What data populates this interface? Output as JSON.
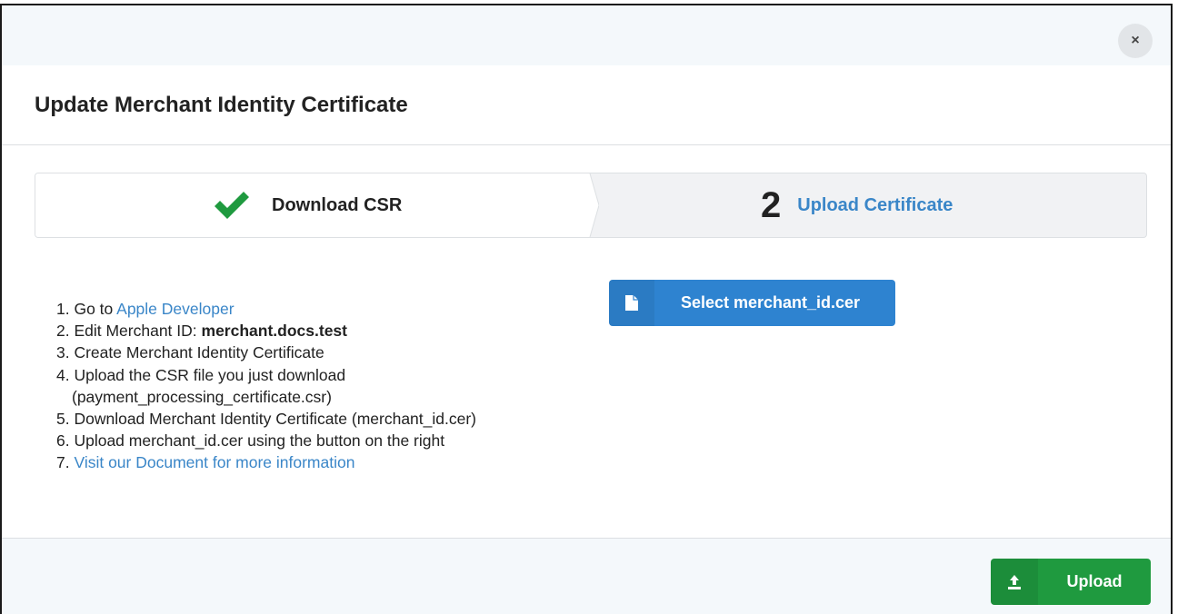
{
  "modal": {
    "title": "Update Merchant Identity Certificate",
    "close_symbol": "×"
  },
  "steps": [
    {
      "label": "Download CSR",
      "status": "completed",
      "icon": "check-icon"
    },
    {
      "number": "2",
      "label": "Upload Certificate",
      "status": "active"
    }
  ],
  "instructions": {
    "item1_prefix": "1. Go to ",
    "item1_link": "Apple Developer",
    "item2_prefix": "2. Edit Merchant ID: ",
    "item2_bold": "merchant.docs.test",
    "item3": "3. Create Merchant Identity Certificate",
    "item4_line1": "4. Upload the CSR file you just download",
    "item4_line2": "(payment_processing_certificate.csr)",
    "item5": "5. Download Merchant Identity Certificate (merchant_id.cer)",
    "item6": "6. Upload merchant_id.cer using the button on the right",
    "item7_prefix": "7. ",
    "item7_link": "Visit our Document for more information"
  },
  "select_button": {
    "label": "Select merchant_id.cer",
    "icon": "file-icon"
  },
  "upload_button": {
    "label": "Upload",
    "icon": "upload-icon"
  },
  "colors": {
    "link": "#3a86c8",
    "primary_button": "#2e83d0",
    "success_button": "#1f9a3f",
    "check": "#1f9a3f"
  }
}
